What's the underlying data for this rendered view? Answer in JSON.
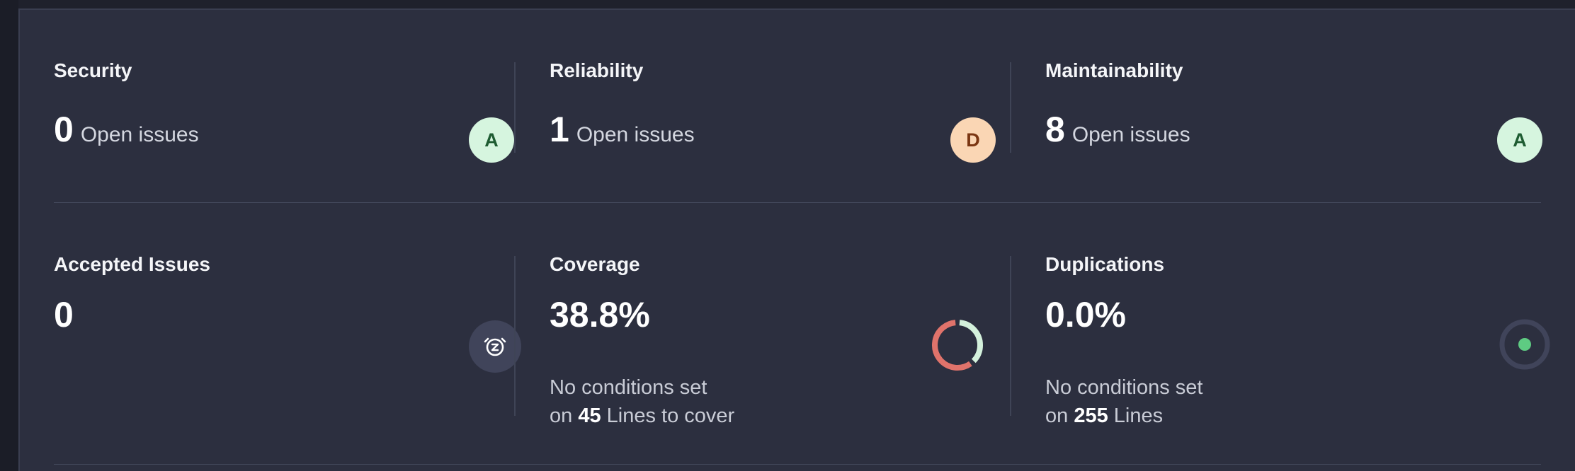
{
  "security": {
    "title": "Security",
    "value": "0",
    "unit": "Open issues",
    "rating": "A"
  },
  "reliability": {
    "title": "Reliability",
    "value": "1",
    "unit": "Open issues",
    "rating": "D"
  },
  "maintainability": {
    "title": "Maintainability",
    "value": "8",
    "unit": "Open issues",
    "rating": "A"
  },
  "accepted": {
    "title": "Accepted Issues",
    "value": "0",
    "icon": "snooze-clock-icon"
  },
  "coverage": {
    "title": "Coverage",
    "value": "38.8%",
    "line1": "No conditions set",
    "line2_prefix": "on",
    "line2_count": "45",
    "line2_suffix": "Lines to cover",
    "percent": 38.8,
    "icon": "coverage-donut-icon",
    "covered_color": "#d4f1dc",
    "uncovered_color": "#e0736b"
  },
  "duplications": {
    "title": "Duplications",
    "value": "0.0%",
    "line1": "No conditions set",
    "line2_prefix": "on",
    "line2_count": "255",
    "line2_suffix": "Lines",
    "icon": "duplications-indicator-icon",
    "indicator_color": "#5ecb82"
  },
  "colors": {
    "rating_a_bg": "#d6f5df",
    "rating_d_bg": "#fad6b4",
    "panel_bg": "#2c2f3f"
  }
}
